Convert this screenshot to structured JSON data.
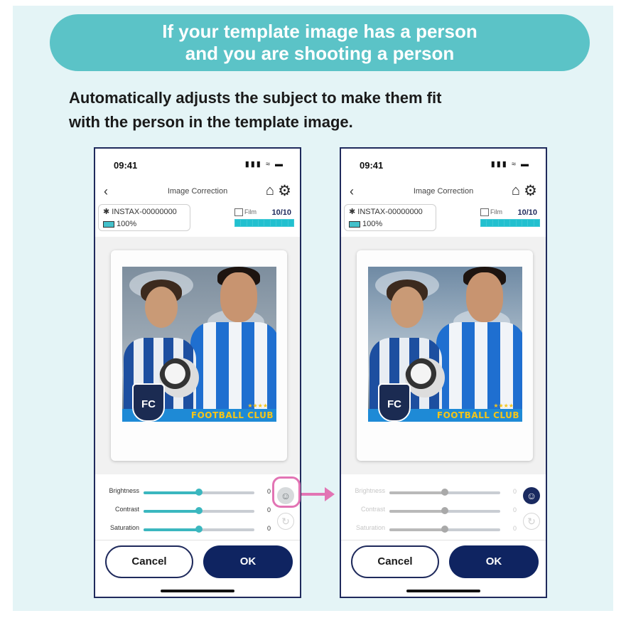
{
  "banner": {
    "line1": "If your template image has a person",
    "line2": "and you are shooting a person"
  },
  "description": {
    "line1": "Automatically adjusts the subject to make them fit",
    "line2": "with the person in the template image."
  },
  "screens": [
    {
      "status_time": "09:41",
      "nav_title": "Image Correction",
      "device_name": "INSTAX-00000000",
      "battery": "100%",
      "film_label": "Film",
      "film_count": "10/10",
      "photo": {
        "club_name": "FOOTBALL CLUB",
        "badge": "FC"
      },
      "sliders": [
        {
          "label": "Brightness",
          "value": "0",
          "level": 0.5
        },
        {
          "label": "Contrast",
          "value": "0",
          "level": 0.5
        },
        {
          "label": "Saturation",
          "value": "0",
          "level": 0.5
        }
      ],
      "auto_correct_state": "off",
      "cancel_label": "Cancel",
      "ok_label": "OK"
    },
    {
      "status_time": "09:41",
      "nav_title": "Image Correction",
      "device_name": "INSTAX-00000000",
      "battery": "100%",
      "film_label": "Film",
      "film_count": "10/10",
      "photo": {
        "club_name": "FOOTBALL CLUB",
        "badge": "FC"
      },
      "sliders": [
        {
          "label": "Brightness",
          "value": "0",
          "level": 0.5
        },
        {
          "label": "Contrast",
          "value": "0",
          "level": 0.5
        },
        {
          "label": "Saturation",
          "value": "0",
          "level": 0.5
        }
      ],
      "auto_correct_state": "on",
      "cancel_label": "Cancel",
      "ok_label": "OK"
    }
  ],
  "colors": {
    "banner": "#5bc3c7",
    "panel": "#e4f4f6",
    "accent": "#3bb7bf",
    "button_dark": "#0f2461",
    "highlight": "#e274b4"
  }
}
